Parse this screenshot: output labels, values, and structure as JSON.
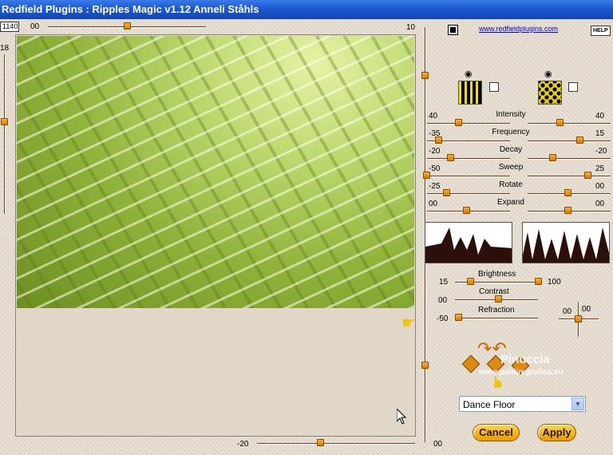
{
  "window": {
    "title": "Redfield Plugins : Ripples Magic v1.12   Anneli Ståhls"
  },
  "top": {
    "count_box": "1140",
    "left_value": "00",
    "right_value": "10"
  },
  "left": {
    "value": "18"
  },
  "bottom": {
    "left_value": "-20",
    "right_value": "00"
  },
  "header": {
    "link": "www.redfieldplugins.com",
    "help": "HELP"
  },
  "sliders": [
    {
      "label": "Intensity",
      "left": "40",
      "right": "40"
    },
    {
      "label": "Frequency",
      "left": "-35",
      "right": "15"
    },
    {
      "label": "Decay",
      "left": "-20",
      "right": "-20"
    },
    {
      "label": "Sweep",
      "left": "-50",
      "right": "25"
    },
    {
      "label": "Rotate",
      "left": "-25",
      "right": "00"
    },
    {
      "label": "Expand",
      "left": "00",
      "right": "00"
    }
  ],
  "lower": {
    "brightness_label": "Brightness",
    "brightness_left": "15",
    "brightness_right": "100",
    "contrast_label": "Contrast",
    "contrast_left": "00",
    "refraction_label": "Refraction",
    "refraction_left": "-50",
    "pos_a": "00",
    "pos_b": "00"
  },
  "watermark": {
    "line1": "Pinuccia",
    "line2": "www.paidiregrafica.eu"
  },
  "preset": {
    "selected": "Dance Floor"
  },
  "buttons": {
    "cancel": "Cancel",
    "apply": "Apply"
  },
  "colors": {
    "title_bar": "#1b58cf",
    "accent": "#e89b00",
    "slider": "#6b3b16"
  }
}
